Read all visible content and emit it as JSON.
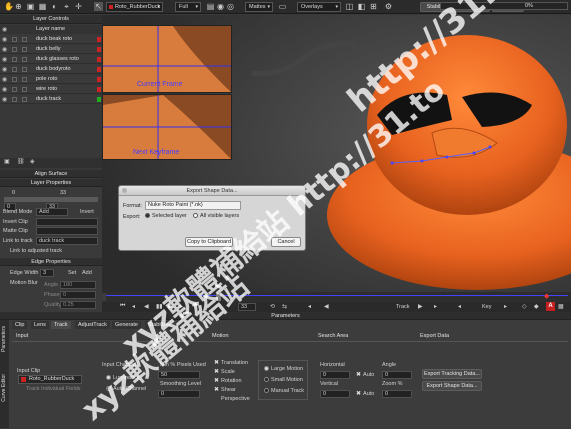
{
  "topbar": {
    "layer_select": "Roto_RubberDuck",
    "resolution": "Full",
    "mattes": "Mattes",
    "overlays": "Overlays",
    "stabilize": "Stabilize",
    "trace": "Trace",
    "preview": "Preview",
    "progress_pct": "0%",
    "progress": 0
  },
  "layer_controls": {
    "title": "Layer Controls",
    "column_header": "Layer name",
    "layers": [
      {
        "name": "duck beak roto",
        "color": "#cc2222"
      },
      {
        "name": "duck belly",
        "color": "#cc2222"
      },
      {
        "name": "duck glasses roto",
        "color": "#cc2222"
      },
      {
        "name": "duck bodyroto",
        "color": "#cc2222"
      },
      {
        "name": "pole roto",
        "color": "#cc2222"
      },
      {
        "name": "wire roto",
        "color": "#cc2222"
      },
      {
        "name": "duck track",
        "color": "#22aa22"
      }
    ]
  },
  "align_surface": {
    "title": "Align Surface"
  },
  "layer_properties": {
    "title": "Layer Properties",
    "frame_start": "0",
    "frame_end": "33",
    "frame_start_val": "0",
    "frame_end_val": "33",
    "blend_mode_label": "Blend Mode",
    "blend_mode_value": "Add",
    "invert_label": "Invert",
    "invert_clip_label": "Invert Clip",
    "matte_clip_label": "Matte Clip",
    "link_to_track_label": "Link to track",
    "link_to_track_value": "duck track",
    "link_adjusted_label": "Link to adjusted track"
  },
  "edge_properties": {
    "title": "Edge Properties",
    "edge_width_label": "Edge Width",
    "edge_width_value": "3",
    "set_label": "Set",
    "add_label": "Add",
    "motion_blur_label": "Motion Blur",
    "angle_label": "Angle",
    "angle_value": "180",
    "phase_label": "Phase",
    "phase_value": "0",
    "quality_label": "Quality",
    "quality_value": "0.25"
  },
  "viewer": {
    "current_frame_label": "Current Frame",
    "next_keyframe_label": "Next Keyframe"
  },
  "dialog": {
    "title": "Export Shape Data...",
    "format_label": "Format:",
    "format_value": "Nuke Roto Paint (*.nk)",
    "export_label": "Export:",
    "selected_layer": "Selected layer",
    "all_visible_layers": "All visible layers",
    "copy_button": "Copy to Clipboard",
    "cancel_button": "Cancel"
  },
  "timeline": {
    "frame_value": "33",
    "track_label": "Track",
    "key_label": "Key"
  },
  "parameters": {
    "title": "Parameters",
    "side_tab_params": "Parameters",
    "side_tab_curve": "Curve Editor",
    "tabs": [
      "Clip",
      "Lens",
      "Track",
      "AdjustTrack",
      "Generate",
      "Stabilize"
    ],
    "input_header": "Input",
    "input_channel_header": "Input Channel",
    "motion_header": "Motion",
    "search_area_header": "Search Area",
    "export_data_header": "Export Data",
    "input_clip_label": "Input Clip",
    "input_clip_value": "Roto_RubberDuck",
    "track_individual_fields": "Track Individual Fields",
    "luminance": "Luminance",
    "auto_channel": "Auto Channel",
    "min_pixels_label": "Min % Pixels Used",
    "min_pixels_value": "50",
    "smoothing_label": "Smoothing Level",
    "smoothing_value": "0",
    "translation": "Translation",
    "scale": "Scale",
    "rotation": "Rotation",
    "shear": "Shear",
    "perspective": "Perspective",
    "large_motion": "Large Motion",
    "small_motion": "Small Motion",
    "manual_track": "Manual Track",
    "horizontal_label": "Horizontal",
    "horizontal_value": "0",
    "horizontal_auto": "Auto",
    "vertical_label": "Vertical",
    "vertical_value": "0",
    "vertical_auto": "Auto",
    "angle_label": "Angle",
    "angle_value": "0",
    "zoom_label": "Zoom %",
    "zoom_value": "0",
    "export_tracking": "Export Tracking Data...",
    "export_shape": "Export Shape Data..."
  },
  "watermark": {
    "line1": "http://31.to",
    "line2": "xyz軟體補給站 http://31.to",
    "line3": "xyz軟體補給站"
  },
  "colors": {
    "orange": "#e8621f",
    "timeline_blue": "#4444ff",
    "keyframe_red": "#d02020"
  }
}
